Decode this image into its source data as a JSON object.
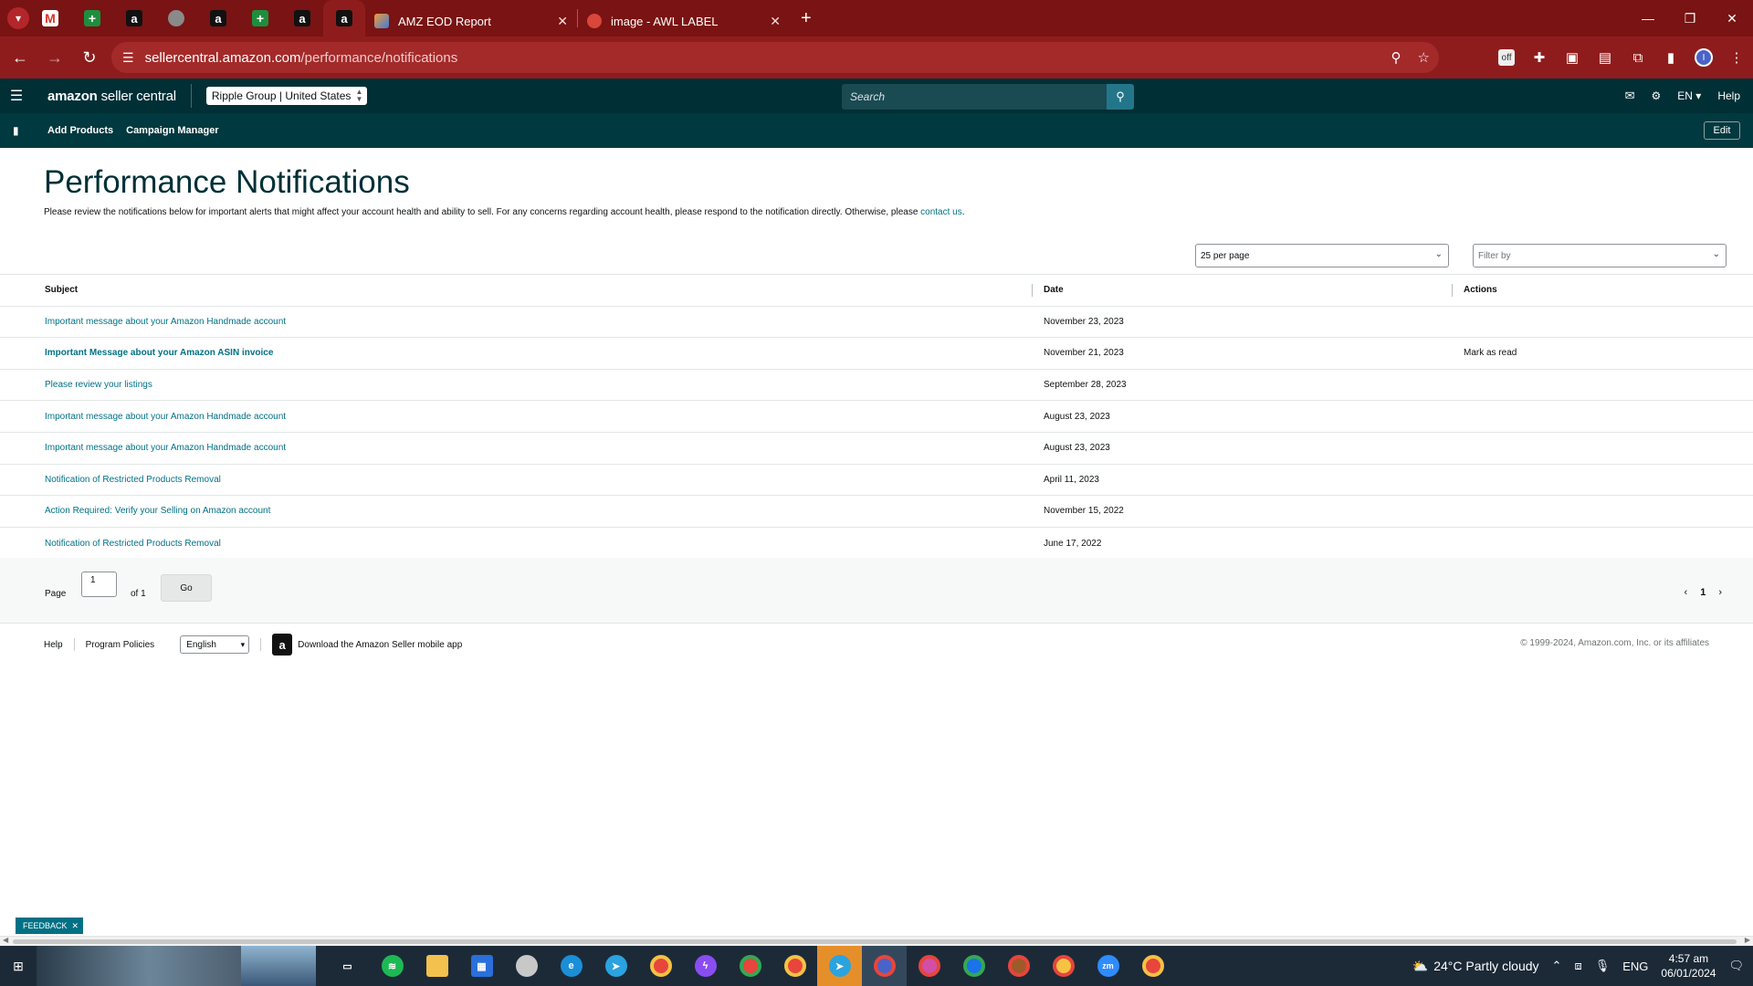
{
  "browser": {
    "tabs": [
      {
        "title": "AMZ EOD Report",
        "active": false
      },
      {
        "title": "image - AWL LABEL",
        "active": false
      }
    ],
    "url_host": "sellercentral.amazon.com",
    "url_path": "/performance/notifications"
  },
  "header": {
    "logo_bold": "amazon",
    "logo_light": "seller central",
    "account": "Ripple Group | United States",
    "search_placeholder": "Search",
    "language": "EN",
    "help": "Help"
  },
  "nav": {
    "items": [
      "Add Products",
      "Campaign Manager"
    ],
    "edit": "Edit"
  },
  "page": {
    "title": "Performance Notifications",
    "intro": "Please review the notifications below for important alerts that might affect your account health and ability to sell. For any concerns regarding account health, please respond to the notification directly. Otherwise, please ",
    "intro_link": "contact us",
    "intro_end": ".",
    "per_page": "25 per page",
    "filter": "Filter by"
  },
  "table": {
    "headers": {
      "subject": "Subject",
      "date": "Date",
      "actions": "Actions"
    },
    "rows": [
      {
        "subject": "Important message about your Amazon Handmade account",
        "date": "November 23, 2023",
        "action": "",
        "unread": false
      },
      {
        "subject": "Important Message about your Amazon ASIN invoice",
        "date": "November 21, 2023",
        "action": "Mark as read",
        "unread": true
      },
      {
        "subject": "Please review your listings",
        "date": "September 28, 2023",
        "action": "",
        "unread": false
      },
      {
        "subject": "Important message about your Amazon Handmade account",
        "date": "August 23, 2023",
        "action": "",
        "unread": false
      },
      {
        "subject": "Important message about your Amazon Handmade account",
        "date": "August 23, 2023",
        "action": "",
        "unread": false
      },
      {
        "subject": "Notification of Restricted Products Removal",
        "date": "April 11, 2023",
        "action": "",
        "unread": false
      },
      {
        "subject": "Action Required: Verify your Selling on Amazon account",
        "date": "November 15, 2022",
        "action": "",
        "unread": false
      },
      {
        "subject": "Notification of Restricted Products Removal",
        "date": "June 17, 2022",
        "action": "",
        "unread": false
      }
    ]
  },
  "pager": {
    "page_label": "Page",
    "page_value": "1",
    "of_label": "of 1",
    "go": "Go",
    "current": "1"
  },
  "footer": {
    "help": "Help",
    "policies": "Program Policies",
    "language": "English",
    "app": "Download the Amazon Seller mobile app",
    "copyright": "© 1999-2024, Amazon.com, Inc. or its affiliates"
  },
  "feedback": "FEEDBACK",
  "taskbar": {
    "weather": "24°C  Partly cloudy",
    "lang": "ENG",
    "time": "4:57 am",
    "date": "06/01/2024"
  },
  "colors": {
    "browser_frame": "#7a1313",
    "sc_header": "#002f36",
    "link": "#007185"
  }
}
